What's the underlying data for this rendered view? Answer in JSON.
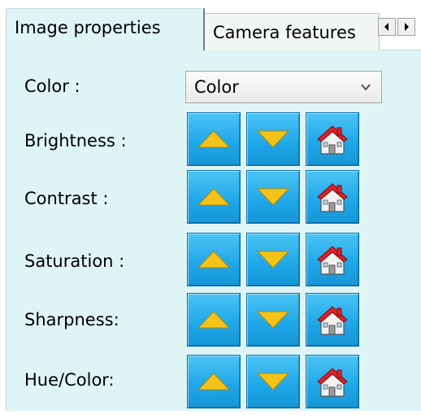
{
  "tabs": [
    {
      "label": "Image properties",
      "active": true
    },
    {
      "label": "Camera features",
      "active": false
    }
  ],
  "tab_scroll": {
    "left_icon": "scroll-left-arrow",
    "right_icon": "scroll-right-arrow"
  },
  "color_field": {
    "label": "Color :",
    "selected": "Color"
  },
  "adjustments": [
    {
      "label": "Brightness :",
      "icons": [
        "up-arrow-icon",
        "down-arrow-icon",
        "home-reset-icon"
      ]
    },
    {
      "label": "Contrast :",
      "icons": [
        "up-arrow-icon",
        "down-arrow-icon",
        "home-reset-icon"
      ]
    },
    {
      "label": "Saturation :",
      "icons": [
        "up-arrow-icon",
        "down-arrow-icon",
        "home-reset-icon"
      ]
    },
    {
      "label": "Sharpness:",
      "icons": [
        "up-arrow-icon",
        "down-arrow-icon",
        "home-reset-icon"
      ]
    },
    {
      "label": "Hue/Color:",
      "icons": [
        "up-arrow-icon",
        "down-arrow-icon",
        "home-reset-icon"
      ]
    }
  ],
  "colors": {
    "panel_bg": "#dff5f5",
    "button_blue": "#1ea6e8",
    "arrow_yellow": "#f3c31a",
    "house_red": "#d9222a"
  }
}
